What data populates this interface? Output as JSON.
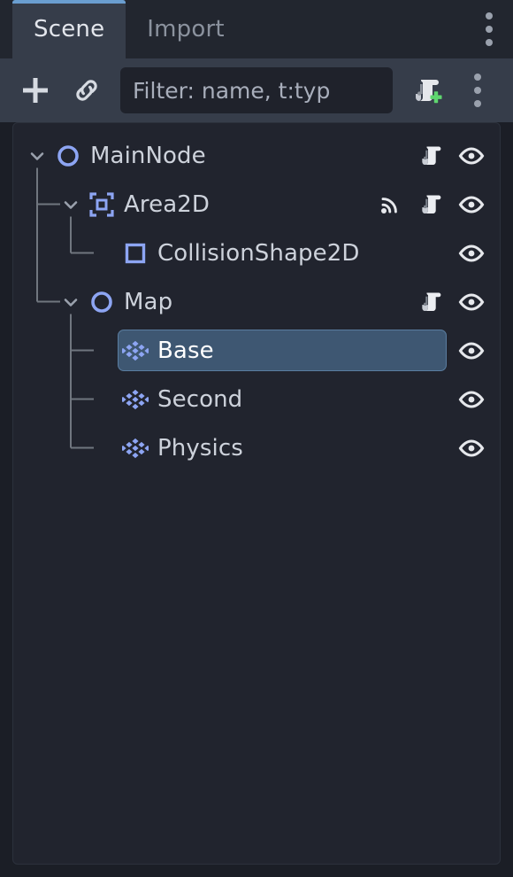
{
  "window": {
    "title": "Scene"
  },
  "colors": {
    "accent_blue": "#6a9ed0",
    "node_icon_blue": "#8da5f3",
    "selection_fill": "#3e5772",
    "selection_border": "#5a7da0",
    "panel_bg": "#21242e",
    "toolbar_bg": "#363d4a",
    "tabbar_bg": "#22262f",
    "script_icon": "#e6e8ec",
    "add_plus_green": "#5fd66f",
    "text_primary": "#cdd2db",
    "text_muted": "#8b929e"
  },
  "tabs": [
    {
      "label": "Scene",
      "active": true,
      "name": "tab-scene"
    },
    {
      "label": "Import",
      "active": false,
      "name": "tab-import"
    }
  ],
  "tabbar": {
    "menu_icon": "dots-vertical-icon"
  },
  "toolbar": {
    "add_node_icon": "plus-icon",
    "instance_scene_icon": "link-icon",
    "attach_script_icon": "script-add-icon",
    "overflow_menu_icon": "dots-vertical-icon"
  },
  "filter": {
    "value": "",
    "placeholder": "Filter: name, t:typ",
    "search_icon": "search-icon"
  },
  "tree": {
    "nodes": [
      {
        "label": "MainNode",
        "depth": 0,
        "icon": "node2d-circle-icon",
        "expanded": true,
        "has_arrow": true,
        "selected": false,
        "has_signal": false,
        "has_script": true,
        "has_visibility": true
      },
      {
        "label": "Area2D",
        "depth": 1,
        "icon": "area2d-icon",
        "expanded": true,
        "has_arrow": true,
        "selected": false,
        "has_signal": true,
        "has_script": true,
        "has_visibility": true
      },
      {
        "label": "CollisionShape2D",
        "depth": 2,
        "icon": "collisionshape2d-square-icon",
        "expanded": false,
        "has_arrow": false,
        "selected": false,
        "has_signal": false,
        "has_script": false,
        "has_visibility": true
      },
      {
        "label": "Map",
        "depth": 1,
        "icon": "node2d-circle-icon",
        "expanded": true,
        "has_arrow": true,
        "selected": false,
        "has_signal": false,
        "has_script": true,
        "has_visibility": true
      },
      {
        "label": "Base",
        "depth": 2,
        "icon": "tilemaplayer-icon",
        "expanded": false,
        "has_arrow": false,
        "selected": true,
        "has_signal": false,
        "has_script": false,
        "has_visibility": true
      },
      {
        "label": "Second",
        "depth": 2,
        "icon": "tilemaplayer-icon",
        "expanded": false,
        "has_arrow": false,
        "selected": false,
        "has_signal": false,
        "has_script": false,
        "has_visibility": true
      },
      {
        "label": "Physics",
        "depth": 2,
        "icon": "tilemaplayer-icon",
        "expanded": false,
        "has_arrow": false,
        "selected": false,
        "has_signal": false,
        "has_script": false,
        "has_visibility": true
      }
    ]
  }
}
